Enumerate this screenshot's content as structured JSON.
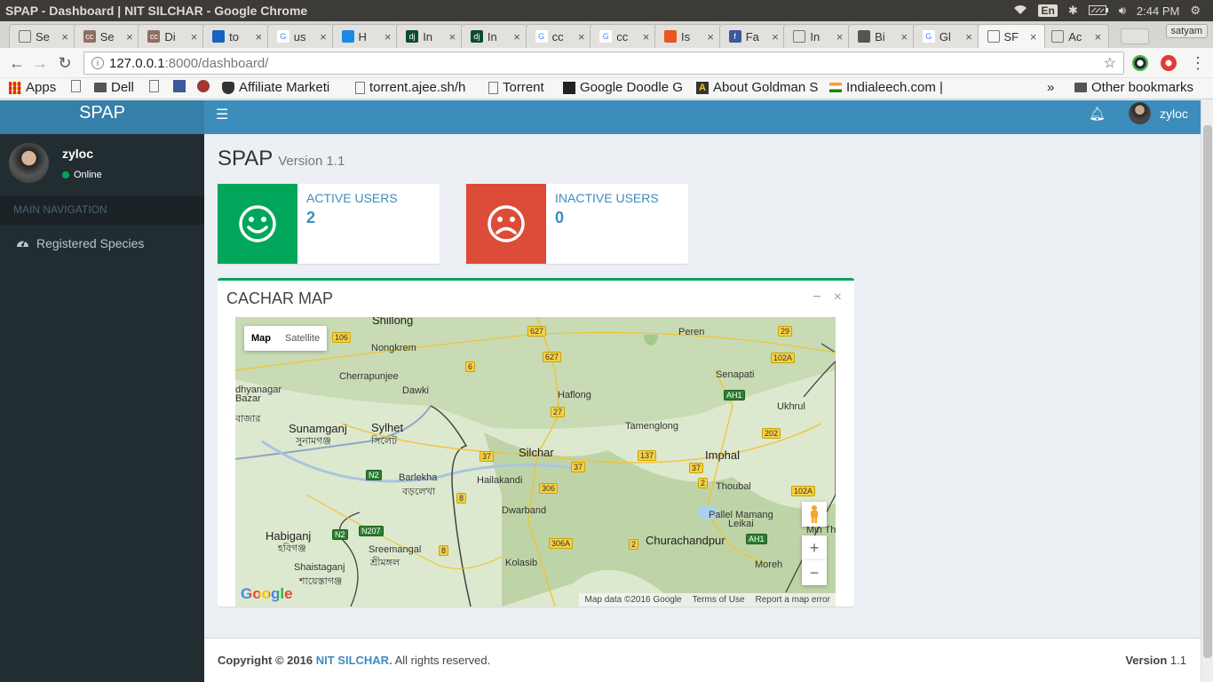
{
  "os": {
    "window_title": "SPAP - Dashboard | NIT SILCHAR - Google Chrome",
    "lang": "En",
    "time": "2:44 PM"
  },
  "browser": {
    "tabs": [
      {
        "label": "Se",
        "fav": "doc"
      },
      {
        "label": "Se",
        "fav": "cc"
      },
      {
        "label": "Di",
        "fav": "cc"
      },
      {
        "label": "to",
        "fav": "shield"
      },
      {
        "label": "us",
        "fav": "google"
      },
      {
        "label": "H",
        "fav": "hook"
      },
      {
        "label": "In",
        "fav": "dj"
      },
      {
        "label": "In",
        "fav": "dj"
      },
      {
        "label": "cc",
        "fav": "google"
      },
      {
        "label": "cc",
        "fav": "google"
      },
      {
        "label": "Is",
        "fav": "ubuntu"
      },
      {
        "label": "Fa",
        "fav": "facebook"
      },
      {
        "label": "In",
        "fav": "pencil"
      },
      {
        "label": "Bi",
        "fav": "image"
      },
      {
        "label": "Gl",
        "fav": "google"
      },
      {
        "label": "SF",
        "fav": "doc",
        "active": true
      },
      {
        "label": "Ac",
        "fav": "doc"
      }
    ],
    "profile": "satyam",
    "url_host": "127.0.0.1",
    "url_path": ":8000/dashboard/",
    "bookmarks": [
      {
        "label": "Apps"
      },
      {
        "label": ""
      },
      {
        "label": "Dell"
      },
      {
        "label": ""
      },
      {
        "label": ""
      },
      {
        "label": ""
      },
      {
        "label": "Affiliate Marketi"
      },
      {
        "label": "torrent.ajee.sh/h"
      },
      {
        "label": "Torrent"
      },
      {
        "label": "Google Doodle G"
      },
      {
        "label": "About Goldman S"
      },
      {
        "label": "Indialeech.com |"
      }
    ],
    "more": "»",
    "other_bookmarks": "Other bookmarks"
  },
  "app": {
    "logo": "SPAP",
    "user": "zyloc",
    "status": "Online",
    "nav_header": "MAIN NAVIGATION",
    "nav_items": [
      "Registered Species"
    ],
    "page_title": "SPAP",
    "page_version": "Version 1.1",
    "info": {
      "active_label": "ACTIVE USERS",
      "active_value": "2",
      "inactive_label": "INACTIVE USERS",
      "inactive_value": "0"
    },
    "map_box": {
      "title": "CACHAR MAP",
      "map_btn": "Map",
      "sat_btn": "Satellite",
      "footer": [
        "Map data ©2016 Google",
        "Terms of Use",
        "Report a map error"
      ],
      "google": "Google",
      "places": {
        "shillong": "Shillong",
        "nongkrem": "Nongkrem",
        "cherrapunjee": "Cherrapunjee",
        "dawki": "Dawki",
        "dhyanagar": "dhyanagar",
        "bazar": "Bazar",
        "bazar_bn": "বাজার",
        "sunamganj": "Sunamganj",
        "sunamganj_bn": "সুনামগঞ্জ",
        "sylhet": "Sylhet",
        "sylhet_bn": "সিলেট",
        "barlekha": "Barlekha",
        "barlekha_bn": "বড়লেখা",
        "hailakandi": "Hailakandi",
        "silchar": "Silchar",
        "dwarband": "Dwarband",
        "habiganj": "Habiganj",
        "habiganj_bn": "হবিগঞ্জ",
        "sreemangal": "Sreemangal",
        "sreemangal_bn": "শ্রীমঙ্গল",
        "shaistaganj": "Shaistaganj",
        "shaistaganj_bn": "শায়েস্তাগঞ্জ",
        "kolasib": "Kolasib",
        "haflong": "Haflong",
        "tamenglong": "Tamenglong",
        "peren": "Peren",
        "senapati": "Senapati",
        "ukhrul": "Ukhrul",
        "imphal": "Imphal",
        "thoubal": "Thoubal",
        "pallel": "Pallel Mamang",
        "leikai": "Leikai",
        "churachandpur": "Churachandpur",
        "moreh": "Moreh",
        "minthar": "Min Tha"
      },
      "shields": {
        "s627a": "627",
        "s627b": "627",
        "s106": "106",
        "s6": "6",
        "s29": "29",
        "s102a": "102A",
        "sah1a": "AH1",
        "s27": "27",
        "s202": "202",
        "s137": "137",
        "s37a": "37",
        "s37b": "37",
        "s37c": "37",
        "s2a": "2",
        "sn2a": "N2",
        "s306": "306",
        "s8a": "8",
        "s102b": "102A",
        "sn2b": "N2",
        "sn207": "N207",
        "s306a": "306A",
        "s2b": "2",
        "sah1b": "AH1",
        "s8b": "8"
      }
    },
    "footer": {
      "copyright": "Copyright © 2016",
      "org": "NIT SILCHAR.",
      "rights": "All rights reserved.",
      "ver_label": "Version",
      "ver_value": "1.1"
    },
    "colors": {
      "header": "#3c8dbc",
      "sidebar": "#222d32",
      "active": "#00a65a",
      "inactive": "#dd4b39"
    }
  }
}
